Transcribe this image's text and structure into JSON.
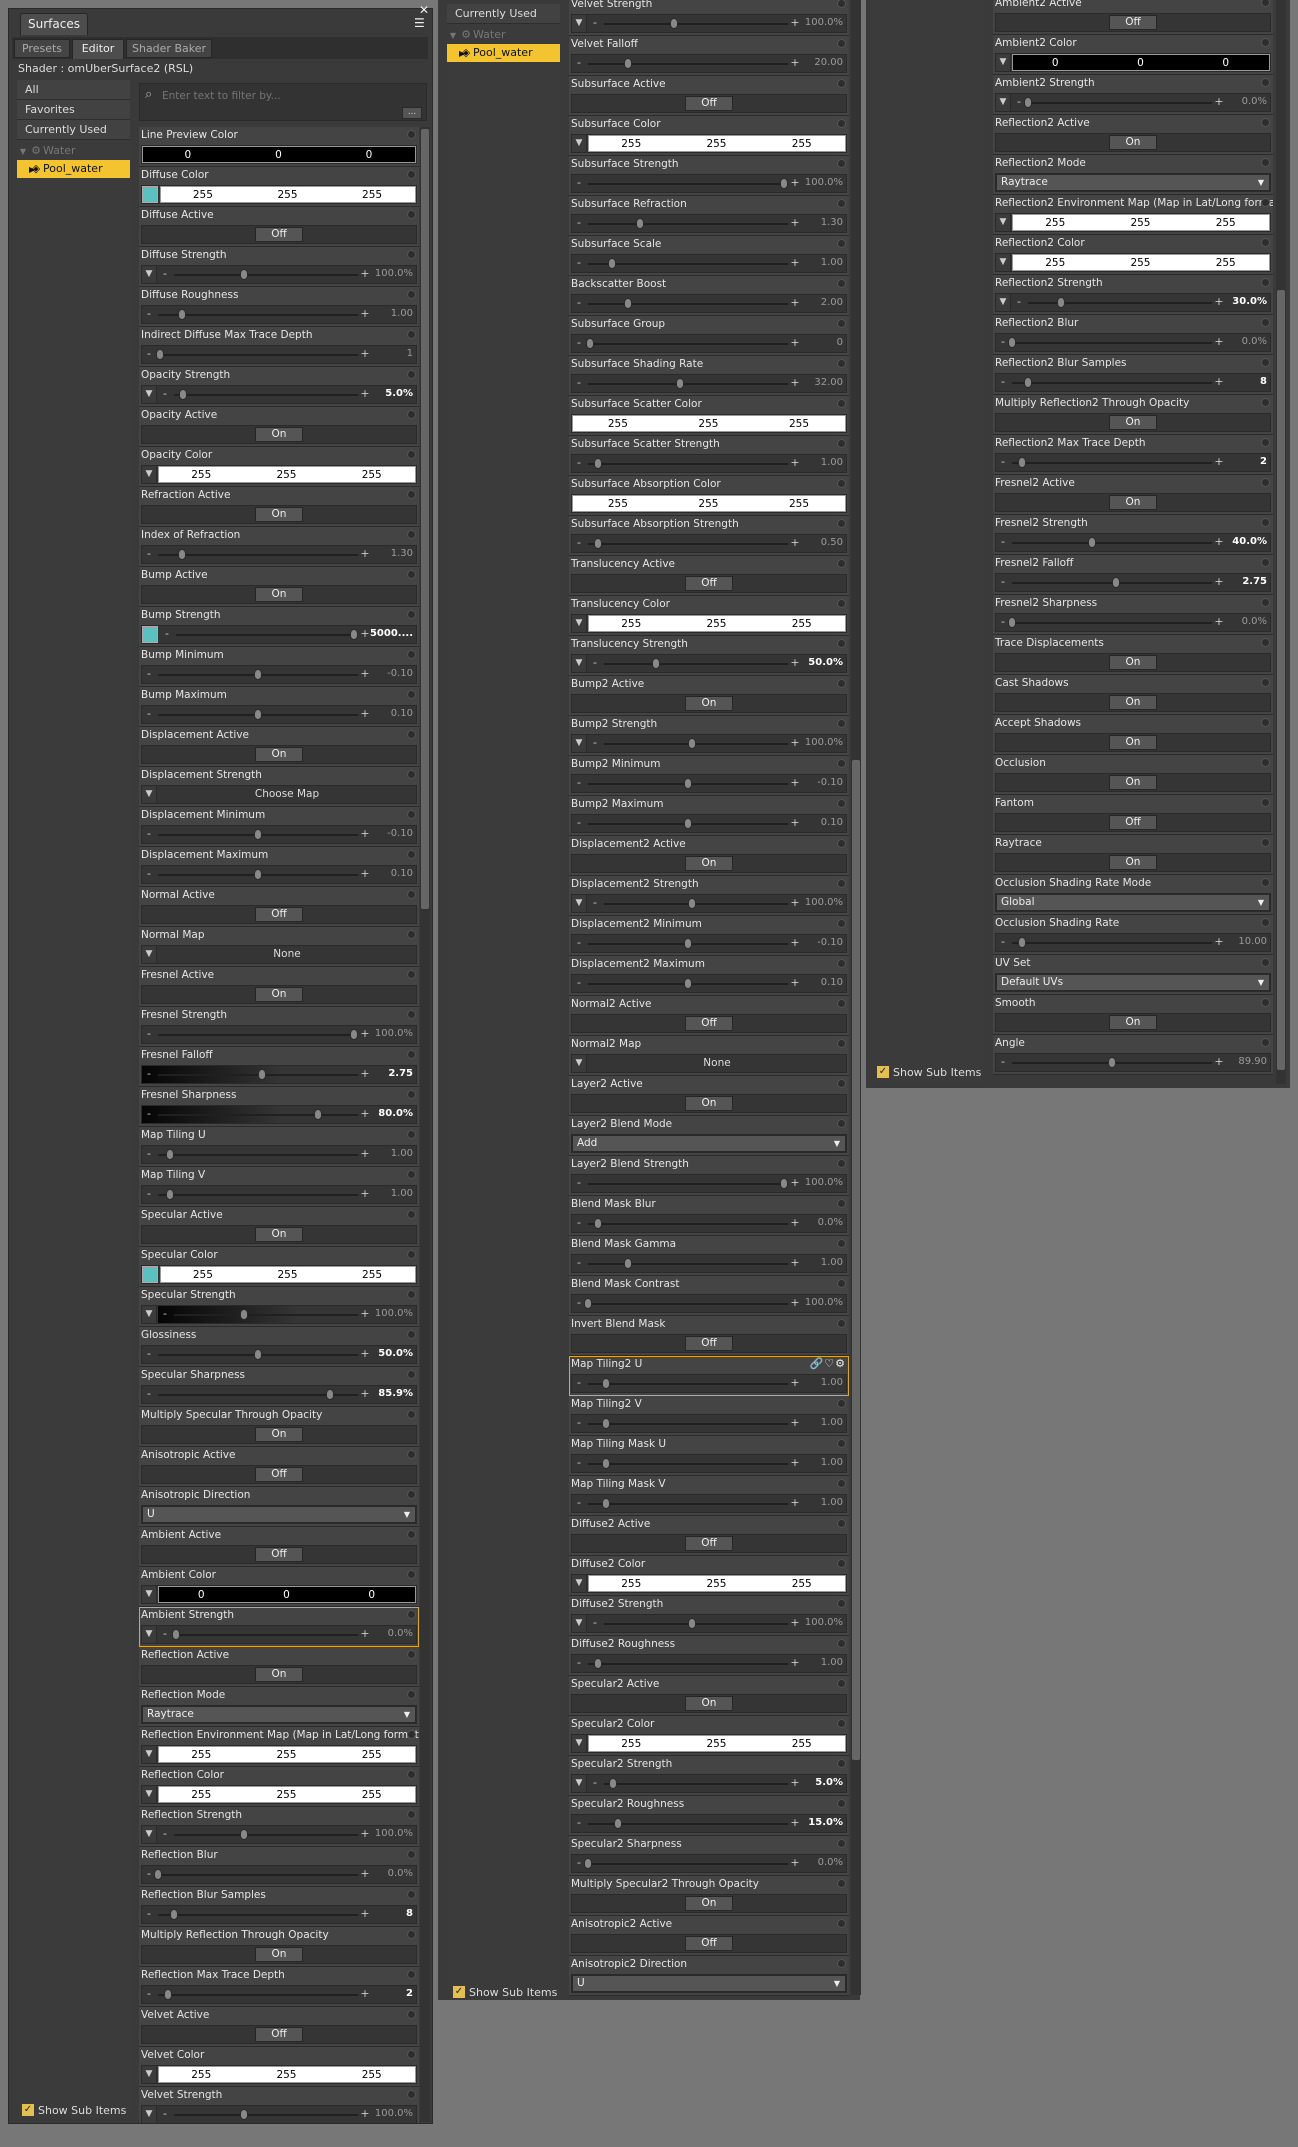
{
  "window": {
    "title": "Surfaces",
    "tabs": [
      "Presets",
      "Editor",
      "Shader Baker"
    ],
    "active_tab": "Editor",
    "shader_label": "Shader : omUberSurface2 (RSL)",
    "filter_placeholder": "Enter text to filter by...",
    "filter_button": "...",
    "show_sub_items": "Show Sub Items"
  },
  "nav": [
    "All",
    "Favorites",
    "Currently Used"
  ],
  "tree": {
    "parent": "Water",
    "child": "Pool_water"
  },
  "nav2": {
    "header": "Currently Used"
  },
  "colors": {
    "swatch": "#5cc0c0",
    "selection": "#f4c430",
    "highlight": "#d8a93a",
    "panel": "#3d3d3d"
  },
  "columns": [
    {
      "name": "left",
      "props": [
        {
          "label": "Line Preview Color",
          "type": "color",
          "v": [
            "0",
            "0",
            "0"
          ],
          "dark": true,
          "drop": false
        },
        {
          "label": "Diffuse Color",
          "type": "color",
          "v": [
            "255",
            "255",
            "255"
          ],
          "swatch": true
        },
        {
          "label": "Diffuse Active",
          "type": "toggle",
          "v": "Off"
        },
        {
          "label": "Diffuse Strength",
          "type": "slider",
          "v": "100.0%",
          "pos": 0.38,
          "drop": true,
          "bold": false
        },
        {
          "label": "Diffuse Roughness",
          "type": "slider",
          "v": "1.00",
          "pos": 0.12
        },
        {
          "label": "Indirect Diffuse Max Trace Depth",
          "type": "slider",
          "v": "1",
          "pos": 0.01
        },
        {
          "label": "Opacity Strength",
          "type": "slider",
          "v": "5.0%",
          "pos": 0.05,
          "drop": true,
          "bold": true
        },
        {
          "label": "Opacity Active",
          "type": "toggle",
          "v": "On"
        },
        {
          "label": "Opacity Color",
          "type": "color",
          "v": [
            "255",
            "255",
            "255"
          ],
          "drop": true
        },
        {
          "label": "Refraction Active",
          "type": "toggle",
          "v": "On"
        },
        {
          "label": "Index of Refraction",
          "type": "slider",
          "v": "1.30",
          "pos": 0.12
        },
        {
          "label": "Bump Active",
          "type": "toggle",
          "v": "On"
        },
        {
          "label": "Bump Strength",
          "type": "slider",
          "v": "5000....",
          "pos": 0.98,
          "swatch": true,
          "bold": true
        },
        {
          "label": "Bump Minimum",
          "type": "slider",
          "v": "-0.10",
          "pos": 0.5
        },
        {
          "label": "Bump Maximum",
          "type": "slider",
          "v": "0.10",
          "pos": 0.5
        },
        {
          "label": "Displacement Active",
          "type": "toggle",
          "v": "On"
        },
        {
          "label": "Displacement Strength",
          "type": "map",
          "v": "Choose Map"
        },
        {
          "label": "Displacement Minimum",
          "type": "slider",
          "v": "-0.10",
          "pos": 0.5
        },
        {
          "label": "Displacement Maximum",
          "type": "slider",
          "v": "0.10",
          "pos": 0.5
        },
        {
          "label": "Normal Active",
          "type": "toggle",
          "v": "Off"
        },
        {
          "label": "Normal Map",
          "type": "map",
          "v": "None"
        },
        {
          "label": "Fresnel Active",
          "type": "toggle",
          "v": "On"
        },
        {
          "label": "Fresnel Strength",
          "type": "slider",
          "v": "100.0%",
          "pos": 0.98
        },
        {
          "label": "Fresnel Falloff",
          "type": "slider",
          "v": "2.75",
          "pos": 0.52,
          "grad": true,
          "bold": true
        },
        {
          "label": "Fresnel Sharpness",
          "type": "slider",
          "v": "80.0%",
          "pos": 0.8,
          "grad": true,
          "bold": true
        },
        {
          "label": "Map Tiling U",
          "type": "slider",
          "v": "1.00",
          "pos": 0.06
        },
        {
          "label": "Map Tiling V",
          "type": "slider",
          "v": "1.00",
          "pos": 0.06
        },
        {
          "label": "Specular Active",
          "type": "toggle",
          "v": "On"
        },
        {
          "label": "Specular Color",
          "type": "color",
          "v": [
            "255",
            "255",
            "255"
          ],
          "swatch": true
        },
        {
          "label": "Specular Strength",
          "type": "slider",
          "v": "100.0%",
          "pos": 0.38,
          "drop": true,
          "grad": true
        },
        {
          "label": "Glossiness",
          "type": "slider",
          "v": "50.0%",
          "pos": 0.5,
          "bold": true
        },
        {
          "label": "Specular Sharpness",
          "type": "slider",
          "v": "85.9%",
          "pos": 0.86,
          "bold": true
        },
        {
          "label": "Multiply Specular Through Opacity",
          "type": "toggle",
          "v": "On"
        },
        {
          "label": "Anisotropic Active",
          "type": "toggle",
          "v": "Off"
        },
        {
          "label": "Anisotropic Direction",
          "type": "select",
          "v": "U"
        },
        {
          "label": "Ambient Active",
          "type": "toggle",
          "v": "Off"
        },
        {
          "label": "Ambient Color",
          "type": "color",
          "v": [
            "0",
            "0",
            "0"
          ],
          "dark": true,
          "drop": true
        },
        {
          "label": "Ambient Strength",
          "type": "slider",
          "v": "0.0%",
          "pos": 0.01,
          "drop": true,
          "hl": true
        },
        {
          "label": "Reflection Active",
          "type": "toggle",
          "v": "On"
        },
        {
          "label": "Reflection Mode",
          "type": "select",
          "v": "Raytrace"
        },
        {
          "label": "Reflection Environment Map (Map in Lat/Long format)",
          "type": "color",
          "v": [
            "255",
            "255",
            "255"
          ],
          "drop": true
        },
        {
          "label": "Reflection Color",
          "type": "color",
          "v": [
            "255",
            "255",
            "255"
          ],
          "drop": true
        },
        {
          "label": "Reflection Strength",
          "type": "slider",
          "v": "100.0%",
          "pos": 0.38,
          "drop": true
        },
        {
          "label": "Reflection Blur",
          "type": "slider",
          "v": "0.0%",
          "pos": 0.0
        },
        {
          "label": "Reflection Blur Samples",
          "type": "slider",
          "v": "8",
          "pos": 0.08,
          "bold": true
        },
        {
          "label": "Multiply Reflection Through Opacity",
          "type": "toggle",
          "v": "On"
        },
        {
          "label": "Reflection Max Trace Depth",
          "type": "slider",
          "v": "2",
          "pos": 0.05,
          "bold": true
        },
        {
          "label": "Velvet Active",
          "type": "toggle",
          "v": "Off"
        },
        {
          "label": "Velvet Color",
          "type": "color",
          "v": [
            "255",
            "255",
            "255"
          ],
          "drop": true
        },
        {
          "label": "Velvet Strength",
          "type": "slider",
          "v": "100.0%",
          "pos": 0.38,
          "drop": true
        }
      ]
    },
    {
      "name": "middle",
      "props": [
        {
          "label": "Velvet Strength",
          "type": "slider",
          "v": "100.0%",
          "pos": 0.38,
          "drop": true
        },
        {
          "label": "Velvet Falloff",
          "type": "slider",
          "v": "20.00",
          "pos": 0.2
        },
        {
          "label": "Subsurface Active",
          "type": "toggle",
          "v": "Off"
        },
        {
          "label": "Subsurface Color",
          "type": "color",
          "v": [
            "255",
            "255",
            "255"
          ],
          "drop": true
        },
        {
          "label": "Subsurface Strength",
          "type": "slider",
          "v": "100.0%",
          "pos": 0.98
        },
        {
          "label": "Subsurface Refraction",
          "type": "slider",
          "v": "1.30",
          "pos": 0.26
        },
        {
          "label": "Subsurface Scale",
          "type": "slider",
          "v": "1.00",
          "pos": 0.12
        },
        {
          "label": "Backscatter Boost",
          "type": "slider",
          "v": "2.00",
          "pos": 0.2
        },
        {
          "label": "Subsurface Group",
          "type": "slider",
          "v": "0",
          "pos": 0.01
        },
        {
          "label": "Subsurface Shading Rate",
          "type": "slider",
          "v": "32.00",
          "pos": 0.46
        },
        {
          "label": "Subsurface Scatter Color",
          "type": "color",
          "v": [
            "255",
            "255",
            "255"
          ]
        },
        {
          "label": "Subsurface Scatter Strength",
          "type": "slider",
          "v": "1.00",
          "pos": 0.05
        },
        {
          "label": "Subsurface Absorption Color",
          "type": "color",
          "v": [
            "255",
            "255",
            "255"
          ]
        },
        {
          "label": "Subsurface Absorption Strength",
          "type": "slider",
          "v": "0.50",
          "pos": 0.05
        },
        {
          "label": "Translucency Active",
          "type": "toggle",
          "v": "Off"
        },
        {
          "label": "Translucency Color",
          "type": "color",
          "v": [
            "255",
            "255",
            "255"
          ],
          "drop": true
        },
        {
          "label": "Translucency Strength",
          "type": "slider",
          "v": "50.0%",
          "pos": 0.28,
          "drop": true,
          "bold": true
        },
        {
          "label": "Bump2 Active",
          "type": "toggle",
          "v": "On"
        },
        {
          "label": "Bump2 Strength",
          "type": "slider",
          "v": "100.0%",
          "pos": 0.48,
          "drop": true
        },
        {
          "label": "Bump2 Minimum",
          "type": "slider",
          "v": "-0.10",
          "pos": 0.5
        },
        {
          "label": "Bump2 Maximum",
          "type": "slider",
          "v": "0.10",
          "pos": 0.5
        },
        {
          "label": "Displacement2 Active",
          "type": "toggle",
          "v": "On"
        },
        {
          "label": "Displacement2 Strength",
          "type": "slider",
          "v": "100.0%",
          "pos": 0.48,
          "drop": true
        },
        {
          "label": "Displacement2 Minimum",
          "type": "slider",
          "v": "-0.10",
          "pos": 0.5
        },
        {
          "label": "Displacement2 Maximum",
          "type": "slider",
          "v": "0.10",
          "pos": 0.5
        },
        {
          "label": "Normal2 Active",
          "type": "toggle",
          "v": "Off"
        },
        {
          "label": "Normal2 Map",
          "type": "map",
          "v": "None"
        },
        {
          "label": "Layer2 Active",
          "type": "toggle",
          "v": "On"
        },
        {
          "label": "Layer2 Blend Mode",
          "type": "select",
          "v": "Add"
        },
        {
          "label": "Layer2 Blend Strength",
          "type": "slider",
          "v": "100.0%",
          "pos": 0.98
        },
        {
          "label": "Blend Mask Blur",
          "type": "slider",
          "v": "0.0%",
          "pos": 0.05
        },
        {
          "label": "Blend Mask Gamma",
          "type": "slider",
          "v": "1.00",
          "pos": 0.2
        },
        {
          "label": "Blend Mask Contrast",
          "type": "slider",
          "v": "100.0%",
          "pos": 0.0
        },
        {
          "label": "Invert Blend Mask",
          "type": "toggle",
          "v": "Off"
        },
        {
          "label": "Map Tiling2 U",
          "type": "slider",
          "v": "1.00",
          "pos": 0.09,
          "hl": true,
          "icons": true
        },
        {
          "label": "Map Tiling2 V",
          "type": "slider",
          "v": "1.00",
          "pos": 0.09
        },
        {
          "label": "Map Tiling Mask U",
          "type": "slider",
          "v": "1.00",
          "pos": 0.09
        },
        {
          "label": "Map Tiling Mask V",
          "type": "slider",
          "v": "1.00",
          "pos": 0.09
        },
        {
          "label": "Diffuse2 Active",
          "type": "toggle",
          "v": "Off"
        },
        {
          "label": "Diffuse2 Color",
          "type": "color",
          "v": [
            "255",
            "255",
            "255"
          ],
          "drop": true
        },
        {
          "label": "Diffuse2 Strength",
          "type": "slider",
          "v": "100.0%",
          "pos": 0.48,
          "drop": true
        },
        {
          "label": "Diffuse2 Roughness",
          "type": "slider",
          "v": "1.00",
          "pos": 0.05
        },
        {
          "label": "Specular2 Active",
          "type": "toggle",
          "v": "On"
        },
        {
          "label": "Specular2 Color",
          "type": "color",
          "v": [
            "255",
            "255",
            "255"
          ],
          "drop": true
        },
        {
          "label": "Specular2 Strength",
          "type": "slider",
          "v": "5.0%",
          "pos": 0.05,
          "drop": true,
          "bold": true
        },
        {
          "label": "Specular2 Roughness",
          "type": "slider",
          "v": "15.0%",
          "pos": 0.15,
          "bold": true
        },
        {
          "label": "Specular2 Sharpness",
          "type": "slider",
          "v": "0.0%",
          "pos": 0.0
        },
        {
          "label": "Multiply Specular2 Through Opacity",
          "type": "toggle",
          "v": "On"
        },
        {
          "label": "Anisotropic2 Active",
          "type": "toggle",
          "v": "Off"
        },
        {
          "label": "Anisotropic2 Direction",
          "type": "select",
          "v": "U"
        }
      ]
    },
    {
      "name": "right",
      "props": [
        {
          "label": "Ambient2 Active",
          "type": "toggle",
          "v": "Off"
        },
        {
          "label": "Ambient2 Color",
          "type": "color",
          "v": [
            "0",
            "0",
            "0"
          ],
          "dark": true,
          "drop": true
        },
        {
          "label": "Ambient2 Strength",
          "type": "slider",
          "v": "0.0%",
          "pos": 0.0,
          "drop": true
        },
        {
          "label": "Reflection2 Active",
          "type": "toggle",
          "v": "On"
        },
        {
          "label": "Reflection2 Mode",
          "type": "select",
          "v": "Raytrace"
        },
        {
          "label": "Reflection2 Environment Map (Map in Lat/Long format)",
          "type": "color",
          "v": [
            "255",
            "255",
            "255"
          ],
          "drop": true
        },
        {
          "label": "Reflection2 Color",
          "type": "color",
          "v": [
            "255",
            "255",
            "255"
          ],
          "drop": true
        },
        {
          "label": "Reflection2 Strength",
          "type": "slider",
          "v": "30.0%",
          "pos": 0.18,
          "drop": true,
          "bold": true
        },
        {
          "label": "Reflection2 Blur",
          "type": "slider",
          "v": "0.0%",
          "pos": 0.0
        },
        {
          "label": "Reflection2 Blur Samples",
          "type": "slider",
          "v": "8",
          "pos": 0.08,
          "bold": true
        },
        {
          "label": "Multiply Reflection2 Through Opacity",
          "type": "toggle",
          "v": "On"
        },
        {
          "label": "Reflection2 Max Trace Depth",
          "type": "slider",
          "v": "2",
          "pos": 0.05,
          "bold": true
        },
        {
          "label": "Fresnel2 Active",
          "type": "toggle",
          "v": "On"
        },
        {
          "label": "Fresnel2 Strength",
          "type": "slider",
          "v": "40.0%",
          "pos": 0.4,
          "bold": true
        },
        {
          "label": "Fresnel2 Falloff",
          "type": "slider",
          "v": "2.75",
          "pos": 0.52,
          "bold": true
        },
        {
          "label": "Fresnel2 Sharpness",
          "type": "slider",
          "v": "0.0%",
          "pos": 0.0
        },
        {
          "label": "Trace Displacements",
          "type": "toggle",
          "v": "On"
        },
        {
          "label": "Cast Shadows",
          "type": "toggle",
          "v": "On"
        },
        {
          "label": "Accept Shadows",
          "type": "toggle",
          "v": "On"
        },
        {
          "label": "Occlusion",
          "type": "toggle",
          "v": "On"
        },
        {
          "label": "Fantom",
          "type": "toggle",
          "v": "Off"
        },
        {
          "label": "Raytrace",
          "type": "toggle",
          "v": "On"
        },
        {
          "label": "Occlusion Shading Rate Mode",
          "type": "select",
          "v": "Global"
        },
        {
          "label": "Occlusion Shading Rate",
          "type": "slider",
          "v": "10.00",
          "pos": 0.05
        },
        {
          "label": "UV Set",
          "type": "select",
          "v": "Default UVs"
        },
        {
          "label": "Smooth",
          "type": "toggle",
          "v": "On"
        },
        {
          "label": "Angle",
          "type": "slider",
          "v": "89.90",
          "pos": 0.5
        }
      ]
    }
  ]
}
